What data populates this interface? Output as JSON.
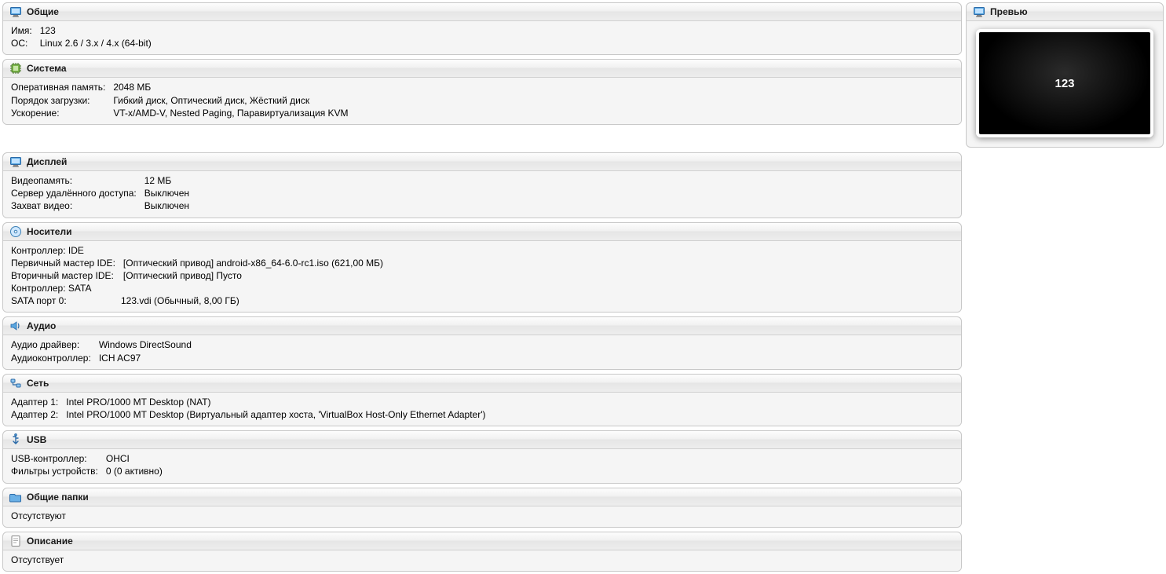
{
  "preview": {
    "title": "Превью",
    "vm_text": "123"
  },
  "general": {
    "title": "Общие",
    "name_label": "Имя:",
    "name_value": "123",
    "os_label": "ОС:",
    "os_value": "Linux 2.6 / 3.x / 4.x (64-bit)"
  },
  "system": {
    "title": "Система",
    "ram_label": "Оперативная память:",
    "ram_value": "2048 МБ",
    "boot_label": "Порядок загрузки:",
    "boot_value": "Гибкий диск, Оптический диск, Жёсткий диск",
    "accel_label": "Ускорение:",
    "accel_value": "VT-x/AMD-V, Nested Paging, Паравиртуализация KVM"
  },
  "display": {
    "title": "Дисплей",
    "vram_label": "Видеопамять:",
    "vram_value": "12 МБ",
    "rdp_label": "Сервер удалённого доступа:",
    "rdp_value": "Выключен",
    "videocap_label": "Захват видео:",
    "videocap_value": "Выключен"
  },
  "storage": {
    "title": "Носители",
    "ctrl_ide": "Контроллер: IDE",
    "ide_primary_label": "Первичный мастер IDE:",
    "ide_primary_value": "[Оптический привод] android-x86_64-6.0-rc1.iso (621,00 МБ)",
    "ide_secondary_label": "Вторичный мастер IDE:",
    "ide_secondary_value": "[Оптический привод] Пусто",
    "ctrl_sata": "Контроллер: SATA",
    "sata0_label": "SATA порт 0:",
    "sata0_value": "123.vdi (Обычный, 8,00 ГБ)"
  },
  "audio": {
    "title": "Аудио",
    "driver_label": "Аудио драйвер:",
    "driver_value": "Windows DirectSound",
    "ctrl_label": "Аудиоконтроллер:",
    "ctrl_value": "ICH AC97"
  },
  "network": {
    "title": "Сеть",
    "a1_label": "Адаптер 1:",
    "a1_value": "Intel PRO/1000 MT Desktop (NAT)",
    "a2_label": "Адаптер 2:",
    "a2_value": "Intel PRO/1000 MT Desktop (Виртуальный адаптер хоста, 'VirtualBox Host-Only Ethernet Adapter')"
  },
  "usb": {
    "title": "USB",
    "ctrl_label": "USB-контроллер:",
    "ctrl_value": "OHCI",
    "filters_label": "Фильтры устройств:",
    "filters_value": "0 (0 активно)"
  },
  "shared": {
    "title": "Общие папки",
    "value": "Отсутствуют"
  },
  "desc": {
    "title": "Описание",
    "value": "Отсутствует"
  }
}
